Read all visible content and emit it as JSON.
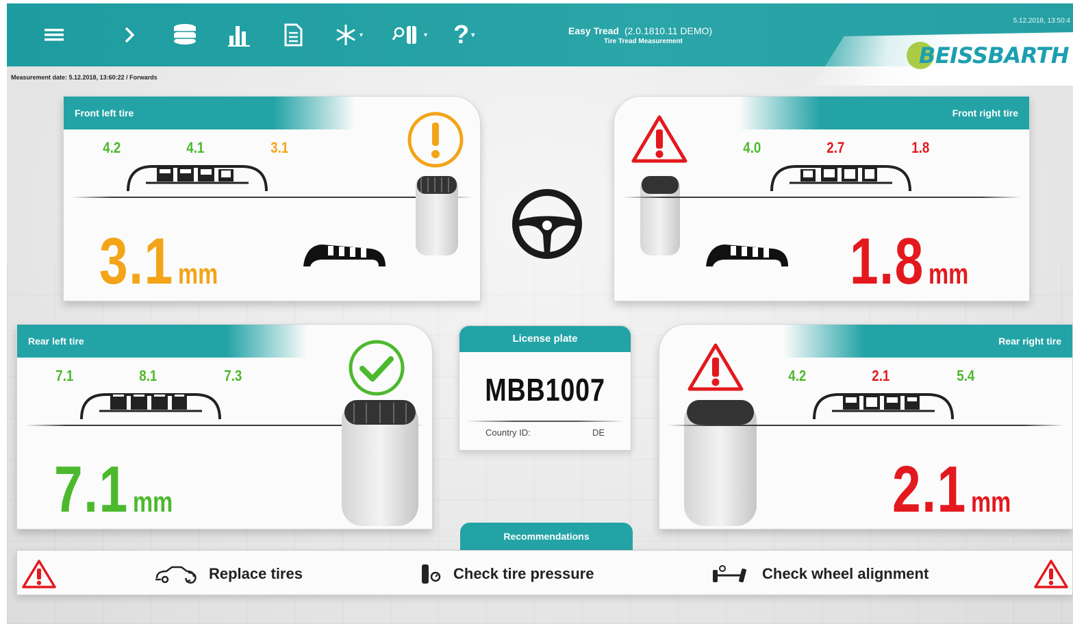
{
  "header": {
    "app_name": "Easy Tread",
    "version": "(2.0.1810.11 DEMO)",
    "subtitle": "Tire Tread Measurement",
    "datetime": "5.12.2018, 13:50:4",
    "brand": "BEISSBARTH",
    "toolbar": [
      {
        "name": "menu-icon"
      },
      {
        "name": "chevron-right-icon"
      },
      {
        "name": "tire-stack-icon"
      },
      {
        "name": "bar-chart-icon"
      },
      {
        "name": "document-icon"
      },
      {
        "name": "snowflake-icon"
      },
      {
        "name": "tire-search-icon"
      },
      {
        "name": "help-icon"
      }
    ]
  },
  "measurement_date": "Measurement date: 5.12.2018, 13:60:22 / Forwards",
  "tires": {
    "front_left": {
      "title": "Front left tire",
      "treads": [
        "4.2",
        "4.1",
        "3.1"
      ],
      "tread_colors": [
        "#4cb92d",
        "#4cb92d",
        "#f3a418"
      ],
      "value": "3.1",
      "unit": "mm",
      "status": "warning",
      "color": "#f3a418"
    },
    "front_right": {
      "title": "Front right tire",
      "treads": [
        "4.0",
        "2.7",
        "1.8"
      ],
      "tread_colors": [
        "#4cb92d",
        "#e3191e",
        "#e3191e"
      ],
      "value": "1.8",
      "unit": "mm",
      "status": "critical",
      "color": "#e3191e"
    },
    "rear_left": {
      "title": "Rear left tire",
      "treads": [
        "7.1",
        "8.1",
        "7.3"
      ],
      "tread_colors": [
        "#4cb92d",
        "#4cb92d",
        "#4cb92d"
      ],
      "value": "7.1",
      "unit": "mm",
      "status": "ok",
      "color": "#4cb92d"
    },
    "rear_right": {
      "title": "Rear right tire",
      "treads": [
        "4.2",
        "2.1",
        "5.4"
      ],
      "tread_colors": [
        "#4cb92d",
        "#e3191e",
        "#4cb92d"
      ],
      "value": "2.1",
      "unit": "mm",
      "status": "critical",
      "color": "#e3191e"
    }
  },
  "license_plate": {
    "title": "License plate",
    "number": "MBB1007",
    "country_label": "Country ID:",
    "country_value": "DE"
  },
  "recommendations": {
    "title": "Recommendations",
    "items": [
      {
        "label": "Replace tires",
        "icon": "car-tire-icon"
      },
      {
        "label": "Check tire pressure",
        "icon": "tire-pressure-icon"
      },
      {
        "label": "Check wheel alignment",
        "icon": "wheel-alignment-icon"
      }
    ]
  },
  "colors": {
    "teal": "#23a3a6",
    "green": "#4cb92d",
    "orange": "#f3a418",
    "red": "#e3191e"
  }
}
